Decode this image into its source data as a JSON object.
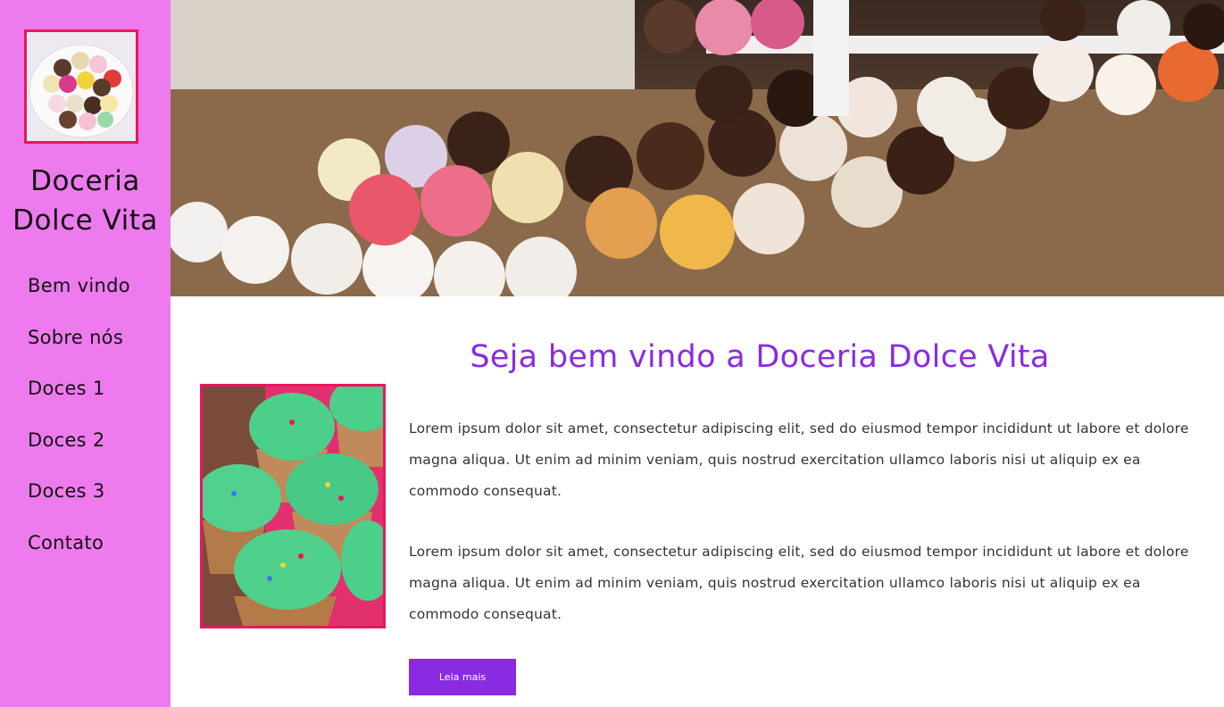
{
  "sidebar": {
    "brand": "Doceria Dolce Vita",
    "nav": [
      "Bem vindo",
      "Sobre nós",
      "Doces 1",
      "Doces 2",
      "Doces 3",
      "Contato"
    ]
  },
  "main": {
    "headline": "Seja bem vindo a Doceria Dolce Vita",
    "paragraphs": [
      "Lorem ipsum dolor sit amet, consectetur adipiscing elit, sed do eiusmod tempor incididunt ut labore et dolore magna aliqua. Ut enim ad minim veniam, quis nostrud exercitation ullamco laboris nisi ut aliquip ex ea commodo consequat.",
      "Lorem ipsum dolor sit amet, consectetur adipiscing elit, sed do eiusmod tempor incididunt ut labore et dolore magna aliqua. Ut enim ad minim veniam, quis nostrud exercitation ullamco laboris nisi ut aliquip ex ea commodo consequat."
    ],
    "button_label": "Leia mais"
  },
  "colors": {
    "sidebar_bg": "#ee7bee",
    "accent": "#8a2be2",
    "frame": "#e8175d"
  }
}
